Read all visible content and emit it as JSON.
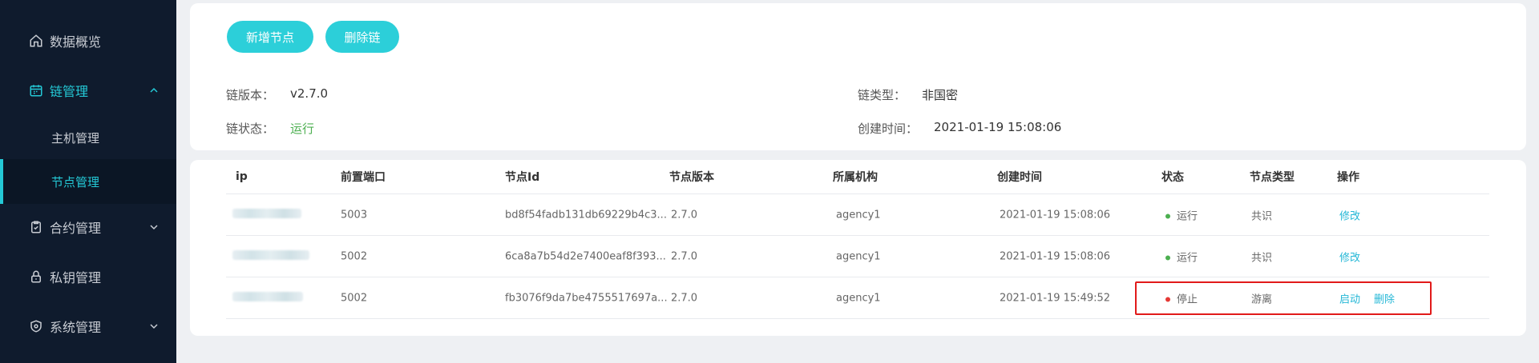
{
  "sidebar": {
    "items": [
      {
        "label": "数据概览",
        "icon": "home-icon"
      },
      {
        "label": "链管理",
        "icon": "calendar-icon"
      },
      {
        "label": "合约管理",
        "icon": "clipboard-icon"
      },
      {
        "label": "私钥管理",
        "icon": "lock-icon"
      },
      {
        "label": "系统管理",
        "icon": "shield-icon"
      }
    ],
    "subitems": [
      {
        "label": "主机管理"
      },
      {
        "label": "节点管理"
      }
    ]
  },
  "toolbar": {
    "add_label": "新增节点",
    "delete_label": "删除链"
  },
  "chain_info": {
    "version_key": "链版本：",
    "version_value": "v2.7.0",
    "type_key": "链类型：",
    "type_value": "非国密",
    "status_key": "链状态：",
    "status_value": "运行",
    "created_key": "创建时间：",
    "created_value": "2021-01-19 15:08:06"
  },
  "table": {
    "headers": [
      "ip",
      "前置端口",
      "节点Id",
      "节点版本",
      "所属机构",
      "创建时间",
      "状态",
      "节点类型",
      "操作"
    ],
    "rows": [
      {
        "port": "5003",
        "node_id": "bd8f54fadb131db69229b4c3...",
        "version": "2.7.0",
        "agency": "agency1",
        "created": "2021-01-19 15:08:06",
        "status": "运行",
        "type": "共识",
        "actions": [
          "修改"
        ]
      },
      {
        "port": "5002",
        "node_id": "6ca8a7b54d2e7400eaf8f393...",
        "version": "2.7.0",
        "agency": "agency1",
        "created": "2021-01-19 15:08:06",
        "status": "运行",
        "type": "共识",
        "actions": [
          "修改"
        ]
      },
      {
        "port": "5002",
        "node_id": "fb3076f9da7be4755517697a...",
        "version": "2.7.0",
        "agency": "agency1",
        "created": "2021-01-19 15:49:52",
        "status": "停止",
        "type": "游离",
        "actions": [
          "启动",
          "删除"
        ]
      }
    ]
  },
  "colors": {
    "accent": "#24c9d6",
    "running": "#4caf50",
    "stopped": "#e53935",
    "highlight": "#e11a1a"
  }
}
